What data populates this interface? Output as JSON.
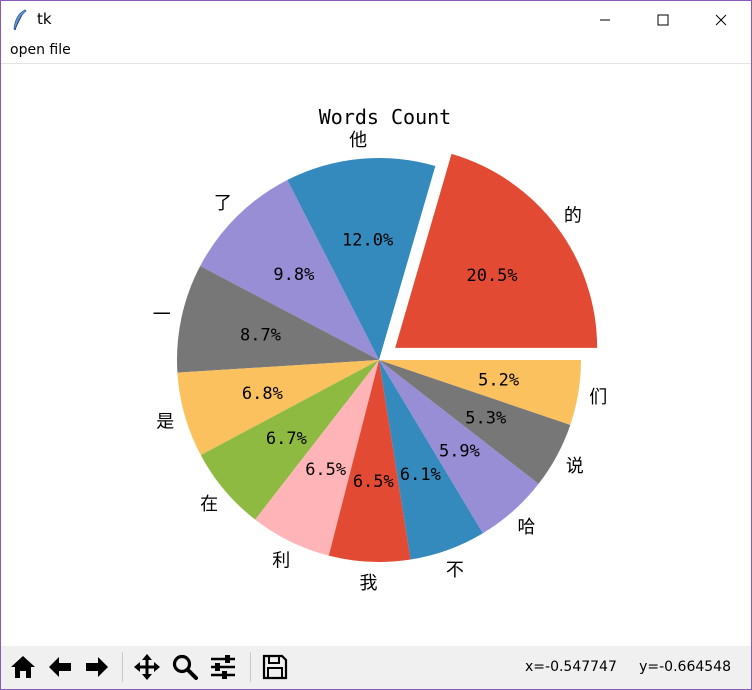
{
  "window": {
    "title": "tk"
  },
  "menu": {
    "open_file": "open file"
  },
  "chart_data": {
    "type": "pie",
    "title": "Words Count",
    "slices": [
      {
        "label": "的",
        "value": 20.5,
        "pct_label": "20.5%",
        "color": "#e24a33",
        "explode": true
      },
      {
        "label": "他",
        "value": 12.0,
        "pct_label": "12.0%",
        "color": "#348abd"
      },
      {
        "label": "了",
        "value": 9.8,
        "pct_label": "9.8%",
        "color": "#988ed5"
      },
      {
        "label": "一",
        "value": 8.7,
        "pct_label": "8.7%",
        "color": "#777777"
      },
      {
        "label": "是",
        "value": 6.8,
        "pct_label": "6.8%",
        "color": "#fbc15e"
      },
      {
        "label": "在",
        "value": 6.7,
        "pct_label": "6.7%",
        "color": "#8eba42"
      },
      {
        "label": "利",
        "value": 6.5,
        "pct_label": "6.5%",
        "color": "#ffb5b8"
      },
      {
        "label": "我",
        "value": 6.5,
        "pct_label": "6.5%",
        "color": "#e24a33"
      },
      {
        "label": "不",
        "value": 6.1,
        "pct_label": "6.1%",
        "color": "#348abd"
      },
      {
        "label": "哈",
        "value": 5.9,
        "pct_label": "5.9%",
        "color": "#988ed5"
      },
      {
        "label": "说",
        "value": 5.3,
        "pct_label": "5.3%",
        "color": "#777777"
      },
      {
        "label": "们",
        "value": 5.2,
        "pct_label": "5.2%",
        "color": "#fbc15e"
      }
    ]
  },
  "toolbar": {
    "buttons": [
      "home-icon",
      "back-arrow-icon",
      "forward-arrow-icon",
      "pan-icon",
      "zoom-icon",
      "configure-subplots-icon",
      "save-icon"
    ],
    "coords": "x=-0.547747     y=-0.664548"
  }
}
